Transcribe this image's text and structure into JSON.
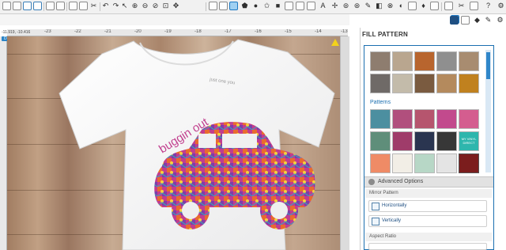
{
  "panel": {
    "title": "FILL PATTERN",
    "patterns_label": "Patterns",
    "advanced_label": "Advanced Options",
    "mirror_label": "Mirror Pattern",
    "horizontally_label": "Horizontally",
    "vertically_label": "Vertically",
    "aspect_label": "Aspect Ratio",
    "my_vinyl_direct_label": "MY VINYL DIRECT"
  },
  "canvas": {
    "design_view_label": "DESIGN VIEW",
    "coords_label": "-11.919, -10.416",
    "onesie_tag_text": "just one you",
    "design_text": "buggin out"
  },
  "ruler": {
    "ticks": [
      "-23",
      "-22",
      "-21",
      "-20",
      "-19",
      "-18",
      "-17",
      "-16",
      "-15",
      "-14",
      "-13"
    ]
  },
  "toolbar": {
    "icons": [
      "new-icon",
      "open-icon",
      "save-icon",
      "save-as-icon",
      "library-icon",
      "print-icon",
      "cut-icon",
      "copy-icon",
      "paste-icon",
      "undo-icon",
      "redo-icon",
      "select-icon",
      "draw-icon",
      "knife-icon",
      "zoom-in-icon",
      "zoom-out-icon",
      "zoom-drag-icon",
      "zoom-fit-icon",
      "pan-icon"
    ]
  },
  "colors": {
    "accent": "#1b6fb0",
    "design_pink": "#c2408f",
    "warning": "#f3d21a"
  }
}
